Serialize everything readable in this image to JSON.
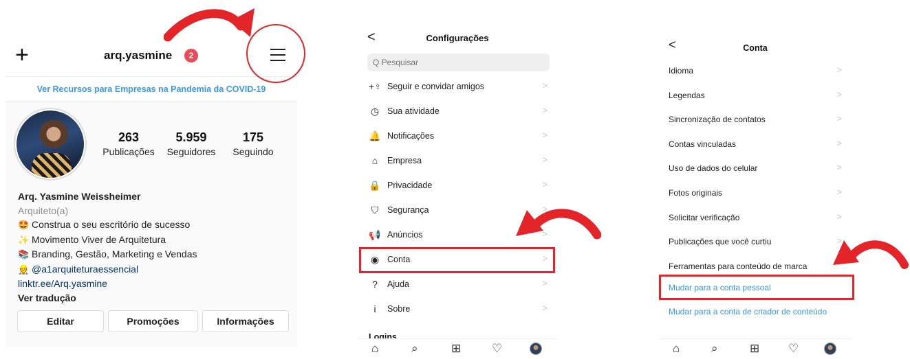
{
  "profile": {
    "username": "arq.yasmine",
    "notification_count": "2",
    "covid_banner": "Ver Recursos para Empresas na Pandemia da COVID-19",
    "stats": [
      {
        "value": "263",
        "label": "Publicações"
      },
      {
        "value": "5.959",
        "label": "Seguidores"
      },
      {
        "value": "175",
        "label": "Seguindo"
      }
    ],
    "name": "Arq. Yasmine Weissheimer",
    "category": "Arquiteto(a)",
    "bio_lines": [
      {
        "emoji": "🤩",
        "text": "Construa o seu escritório de sucesso"
      },
      {
        "emoji": "✨",
        "text": "Movimento Viver de Arquitetura"
      },
      {
        "emoji": "📚",
        "text": "Branding, Gestão, Marketing e Vendas"
      },
      {
        "emoji": "👷",
        "text": "@a1arquiteturaessencial"
      }
    ],
    "link": "linktr.ee/Arq.yasmine",
    "translate": "Ver tradução",
    "buttons": [
      "Editar",
      "Promoções",
      "Informações"
    ]
  },
  "settings": {
    "title": "Configurações",
    "search_placeholder": "Q Pesquisar",
    "items": [
      {
        "icon": "add-person-icon",
        "glyph": "+♀",
        "label": "Seguir e convidar amigos"
      },
      {
        "icon": "activity-icon",
        "glyph": "◷",
        "label": "Sua atividade"
      },
      {
        "icon": "bell-icon",
        "glyph": "🔔",
        "label": "Notificações"
      },
      {
        "icon": "store-icon",
        "glyph": "⌂",
        "label": "Empresa"
      },
      {
        "icon": "lock-icon",
        "glyph": "🔒",
        "label": "Privacidade"
      },
      {
        "icon": "shield-icon",
        "glyph": "⛉",
        "label": "Segurança"
      },
      {
        "icon": "megaphone-icon",
        "glyph": "📢",
        "label": "Anúncios"
      },
      {
        "icon": "account-icon",
        "glyph": "◉",
        "label": "Conta"
      },
      {
        "icon": "help-icon",
        "glyph": "?",
        "label": "Ajuda"
      },
      {
        "icon": "info-icon",
        "glyph": "i",
        "label": "Sobre"
      }
    ],
    "logins_label": "Logins"
  },
  "account": {
    "title": "Conta",
    "items": [
      "Idioma",
      "Legendas",
      "Sincronização de contatos",
      "Contas vinculadas",
      "Uso de dados do celular",
      "Fotos originais",
      "Solicitar verificação",
      "Publicações que você curtiu",
      "Ferramentas para conteúdo de marca"
    ],
    "switch_personal": "Mudar para a conta pessoal",
    "switch_creator": "Mudar para a conta de criador de conteúdo"
  },
  "tabbar": [
    "home-icon",
    "search-icon",
    "add-icon",
    "heart-icon",
    "profile-avatar"
  ],
  "colors": {
    "annotation_red": "#e32428",
    "link_blue": "#3897f0",
    "badge_red": "#ed4956"
  }
}
